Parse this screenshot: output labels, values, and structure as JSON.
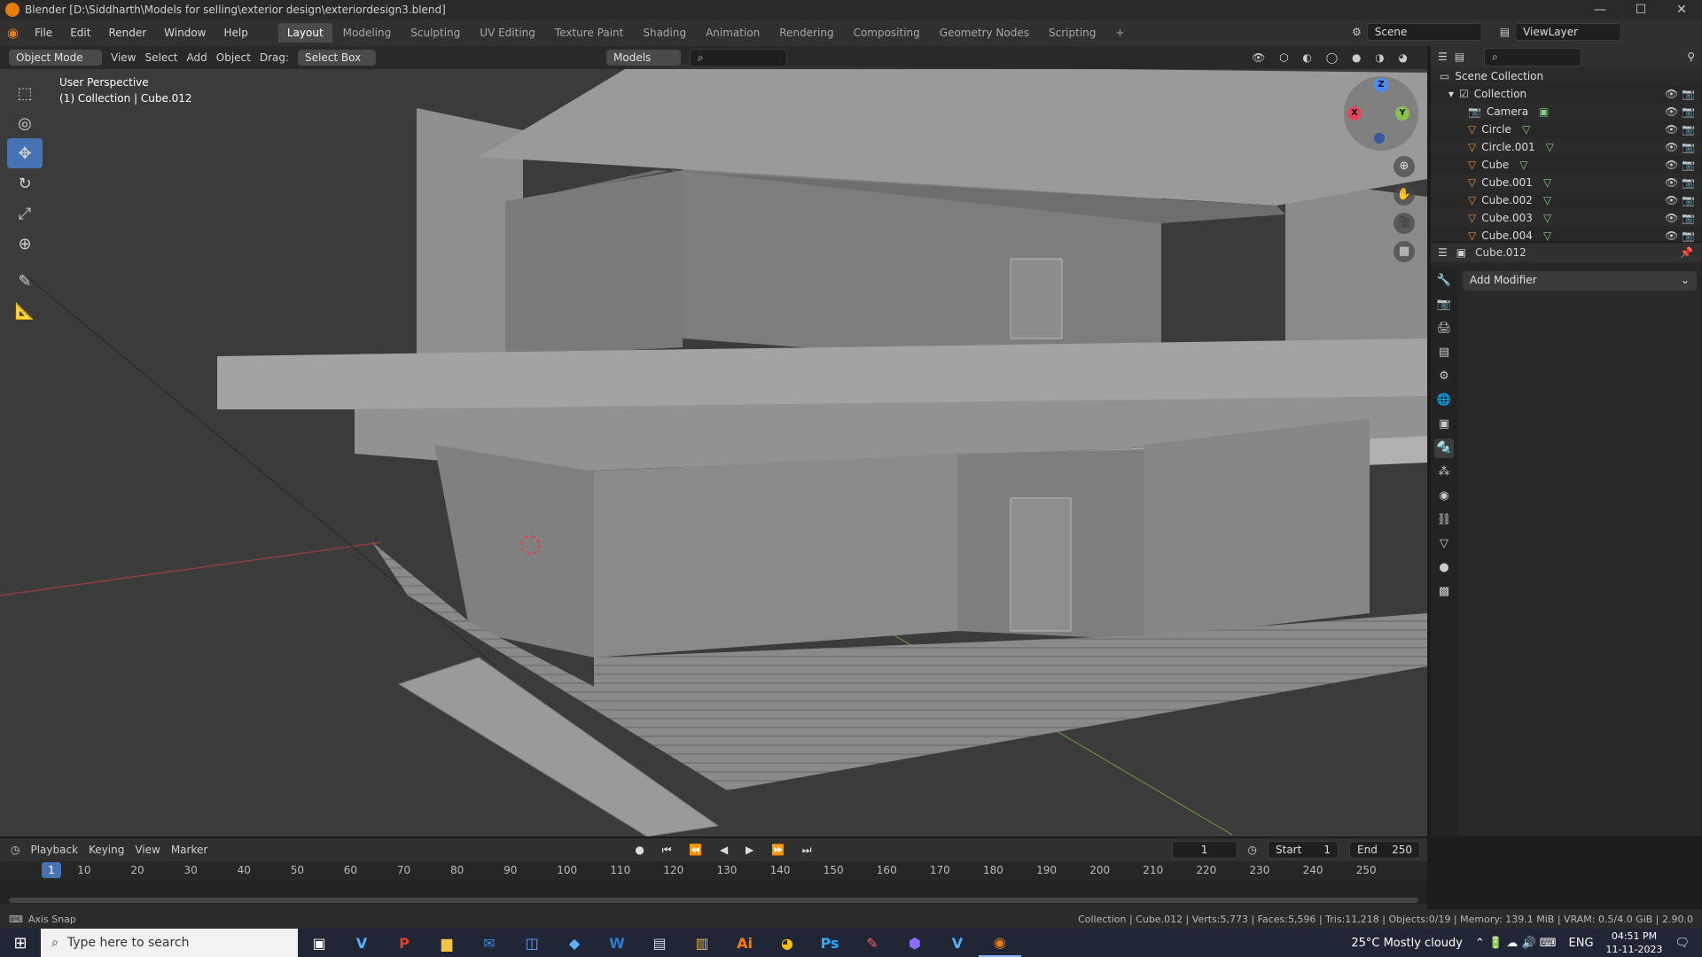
{
  "window": {
    "title": "Blender [D:\\Siddharth\\Models for selling\\exterior design\\exteriordesign3.blend]",
    "controls": [
      "—",
      "☐",
      "✕"
    ]
  },
  "menu": {
    "items": [
      "File",
      "Edit",
      "Render",
      "Window",
      "Help"
    ]
  },
  "workspaces": {
    "tabs": [
      "Layout",
      "Modeling",
      "Sculpting",
      "UV Editing",
      "Texture Paint",
      "Shading",
      "Animation",
      "Rendering",
      "Compositing",
      "Geometry Nodes",
      "Scripting"
    ],
    "active": "Layout",
    "add": "+"
  },
  "scene": {
    "name": "Scene",
    "view_layer": "ViewLayer"
  },
  "viewport": {
    "mode": "Object Mode",
    "menus": [
      "View",
      "Select",
      "Add",
      "Object"
    ],
    "drag_label": "Drag:",
    "drag_value": "Select Box",
    "collection_filter": "Models",
    "info_line1": "User Perspective",
    "info_line2": "(1) Collection | Cube.012",
    "gizmo": {
      "x": "X",
      "y": "Y",
      "z": "Z"
    }
  },
  "tools": [
    {
      "name": "select-box-tool",
      "glyph": "⬚",
      "active": false
    },
    {
      "name": "cursor-tool",
      "glyph": "◎",
      "active": false
    },
    {
      "name": "move-tool",
      "glyph": "✥",
      "active": true
    },
    {
      "name": "rotate-tool",
      "glyph": "↻",
      "active": false
    },
    {
      "name": "scale-tool",
      "glyph": "⤢",
      "active": false
    },
    {
      "name": "transform-tool",
      "glyph": "⊕",
      "active": false
    },
    {
      "name": "annotate-tool",
      "glyph": "✎",
      "active": false
    },
    {
      "name": "measure-tool",
      "glyph": "📐",
      "active": false
    }
  ],
  "outliner": {
    "root": "Scene Collection",
    "collection": "Collection",
    "items": [
      "Camera",
      "Circle",
      "Circle.001",
      "Cube",
      "Cube.001",
      "Cube.002",
      "Cube.003",
      "Cube.004"
    ]
  },
  "properties": {
    "object": "Cube.012",
    "add_modifier": "Add Modifier"
  },
  "timeline": {
    "menus": [
      "Playback",
      "Keying",
      "View",
      "Marker"
    ],
    "current_frame": "1",
    "start_label": "Start",
    "start": "1",
    "end_label": "End",
    "end": "250",
    "ticks": [
      "1",
      "10",
      "20",
      "30",
      "40",
      "50",
      "60",
      "70",
      "80",
      "90",
      "100",
      "110",
      "120",
      "130",
      "140",
      "150",
      "160",
      "170",
      "180",
      "190",
      "200",
      "210",
      "220",
      "230",
      "240",
      "250"
    ]
  },
  "status": {
    "left": "Axis Snap",
    "right": "Collection | Cube.012 | Verts:5,773 | Faces:5,596 | Tris:11,218 | Objects:0/19 | Memory: 139.1 MiB | VRAM: 0.5/4.0 GiB | 2.90.0"
  },
  "taskbar": {
    "search_placeholder": "Type here to search",
    "weather": "25°C  Mostly cloudy",
    "lang": "ENG",
    "time": "04:51 PM",
    "date": "11-11-2023"
  },
  "colors": {
    "accent": "#4772b3",
    "blender_orange": "#e87d0d",
    "x_axis": "#e04758",
    "y_axis": "#8bc34a",
    "z_axis": "#4a8cff"
  }
}
